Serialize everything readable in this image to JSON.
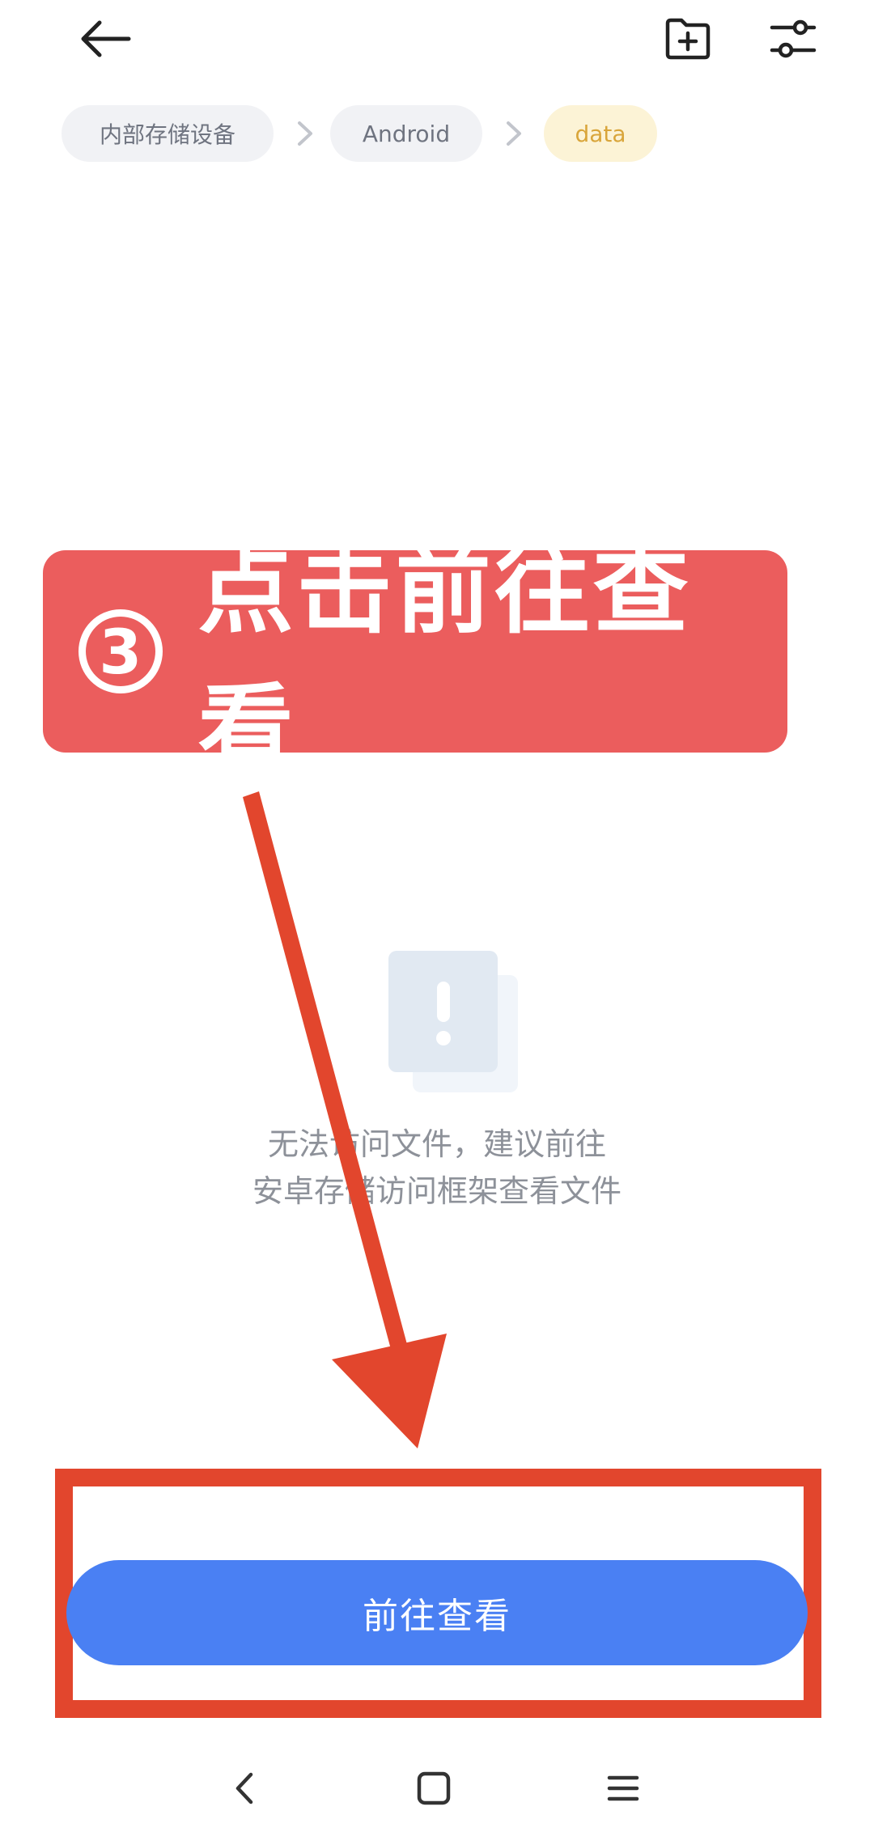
{
  "toolbar": {
    "back_icon": "arrow-left-icon",
    "new_folder_icon": "folder-plus-icon",
    "filter_icon": "sliders-icon"
  },
  "breadcrumb": {
    "items": [
      "内部存储设备",
      "Android",
      "data"
    ],
    "separator_icon": "chevron-right-icon",
    "active_color": "#d9a53a"
  },
  "banner": {
    "number": "3",
    "text": "点击前往查看",
    "color": "#eb5d5d"
  },
  "empty_state": {
    "icon": "alert-document-icon",
    "line1": "无法访问文件，建议前往",
    "line2": "安卓存储访问框架查看文件"
  },
  "action": {
    "button_label": "前往查看",
    "button_color": "#4a80f3",
    "highlight_color": "#e2462d"
  },
  "navbar": {
    "back_icon": "nav-back-icon",
    "home_icon": "nav-home-icon",
    "menu_icon": "nav-menu-icon"
  }
}
